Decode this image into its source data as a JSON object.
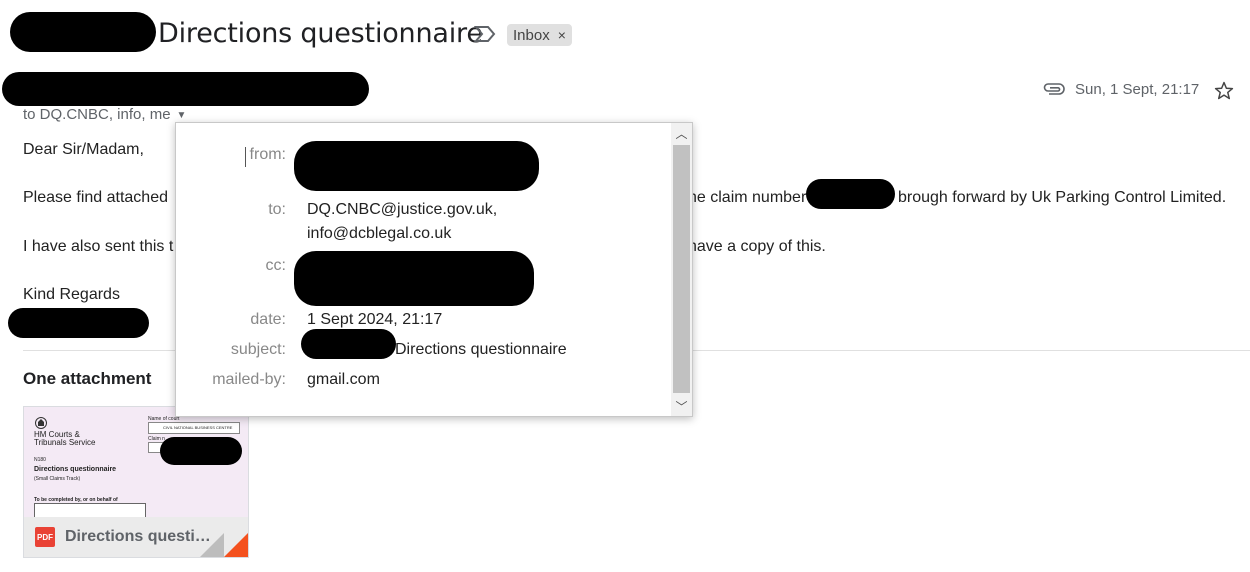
{
  "email": {
    "subject": "Directions questionnaire",
    "label_chip": "Inbox",
    "label_chip_close": "×",
    "to_line": "to DQ.CNBC, info, me",
    "date": "Sun, 1 Sept, 21:17"
  },
  "body": {
    "greeting": "Dear Sir/Madam,",
    "para1_start": "Please find attached",
    "para1_end_a": "he claim number",
    "para1_end_b": "brough forward by Uk Parking Control Limited.",
    "para2_start": "I have also sent this t",
    "para2_end": "have a copy of this.",
    "signoff": "Kind Regards"
  },
  "attachments": {
    "header": "One attachment",
    "file_name": "Directions questi…",
    "file_type": "PDF",
    "preview": {
      "org_line1": "HM Courts &",
      "org_line2": "Tribunals Service",
      "name_of_court": "Name of court",
      "court_value": "CIVIL NATIONAL BUSINESS CENTRE",
      "claim_no": "Claim n",
      "form_code": "N180",
      "form_title": "Directions questionnaire",
      "form_track": "(Small Claims Track)",
      "completed_by": "To be completed by, or on behalf of"
    }
  },
  "details_popup": {
    "from_label": "from:",
    "to_label": "to:",
    "to_value_1": "DQ.CNBC@justice.gov.uk,",
    "to_value_2": "info@dcblegal.co.uk",
    "cc_label": "cc:",
    "date_label": "date:",
    "date_value": "1 Sept 2024, 21:17",
    "subject_label": "subject:",
    "subject_value": "Directions questionnaire",
    "mailedby_label": "mailed-by:",
    "mailedby_value": "gmail.com"
  },
  "colors": {
    "pdf_red": "#e94235",
    "corner_orange": "#f4511e",
    "chip_gray": "#e0e0e0"
  }
}
